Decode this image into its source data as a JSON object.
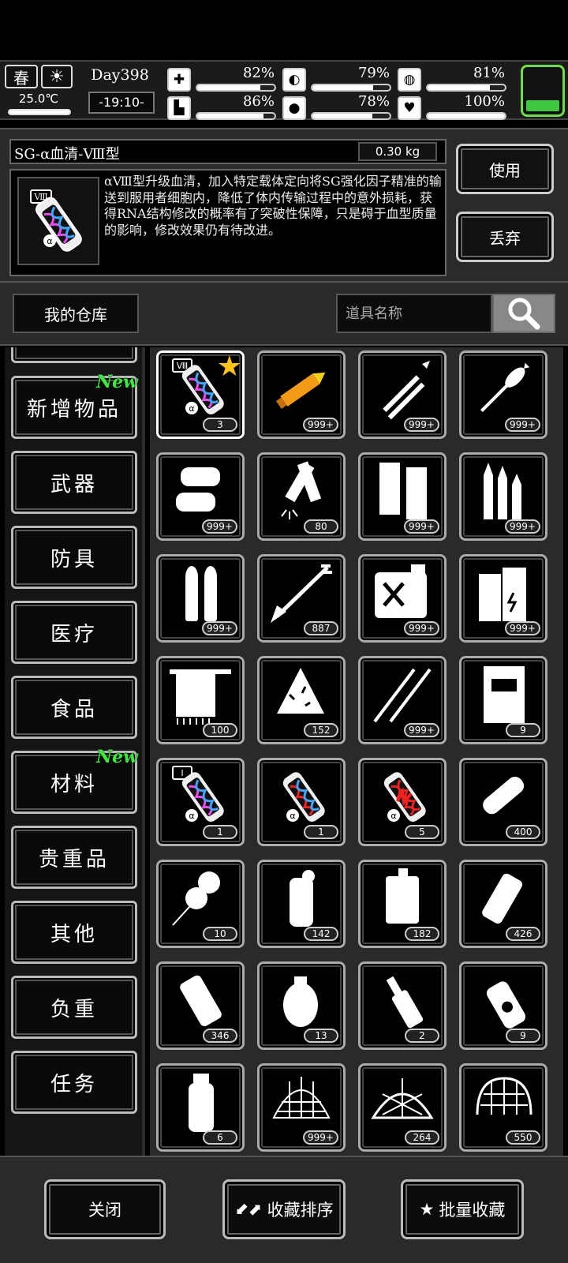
{
  "hud": {
    "season": "春",
    "temperature": "25.0℃",
    "day": "Day398",
    "time": "-19:10-",
    "stats": [
      {
        "name": "health",
        "icon": "medkit-icon",
        "glyph": "✚",
        "value": "82%",
        "level": 0.82
      },
      {
        "name": "hunger",
        "icon": "stomach-icon",
        "glyph": "◐",
        "value": "79%",
        "level": 0.79
      },
      {
        "name": "energy",
        "icon": "pill-icon",
        "glyph": "◍",
        "value": "81%",
        "level": 0.81
      },
      {
        "name": "stamina",
        "icon": "boot-icon",
        "glyph": "▙",
        "value": "86%",
        "level": 0.86
      },
      {
        "name": "thirst",
        "icon": "water-drop-icon",
        "glyph": "●",
        "value": "78%",
        "level": 0.78
      },
      {
        "name": "mood",
        "icon": "heart-icon",
        "glyph": "♥",
        "value": "100%",
        "level": 1.0
      }
    ],
    "battery_color": "#3cc840"
  },
  "detail": {
    "title": "SG-α血清-Ⅷ型",
    "weight": "0.30 kg",
    "description": "αⅧ型升级血清，加入特定载体定向将SG强化因子精准的输送到服用者细胞内，降低了体内传输过程中的意外损耗，获得RNA结构修改的概率有了突破性保障，只是碍于血型质量的影响，修改效果仍有待改进。",
    "use_label": "使用",
    "discard_label": "丢弃"
  },
  "warehouse": {
    "title": "我的仓库",
    "search_placeholder": "道具名称"
  },
  "categories": [
    {
      "label": "新增物品",
      "badge": "New"
    },
    {
      "label": "武器",
      "badge": ""
    },
    {
      "label": "防具",
      "badge": ""
    },
    {
      "label": "医疗",
      "badge": ""
    },
    {
      "label": "食品",
      "badge": ""
    },
    {
      "label": "材料",
      "badge": "New"
    },
    {
      "label": "贵重品",
      "badge": ""
    },
    {
      "label": "其他",
      "badge": ""
    },
    {
      "label": "负重",
      "badge": ""
    },
    {
      "label": "任务",
      "badge": ""
    }
  ],
  "items": [
    {
      "icon": "serum-viii-icon",
      "count": "3",
      "favorite": true,
      "selected": true
    },
    {
      "icon": "rocket-ammo-icon",
      "count": "999+"
    },
    {
      "icon": "rifle-bullets-icon",
      "count": "999+"
    },
    {
      "icon": "rpg-round-icon",
      "count": "999+"
    },
    {
      "icon": "pistol-bullets-icon",
      "count": "999+"
    },
    {
      "icon": "shotgun-shells-icon",
      "count": "80"
    },
    {
      "icon": "magazine-icon",
      "count": "999+"
    },
    {
      "icon": "cartridges-icon",
      "count": "999+"
    },
    {
      "icon": "bullet-pair-icon",
      "count": "999+"
    },
    {
      "icon": "arrow-icon",
      "count": "887"
    },
    {
      "icon": "fuel-can-icon",
      "count": "999+"
    },
    {
      "icon": "battery-pack-icon",
      "count": "999+"
    },
    {
      "icon": "towel-icon",
      "count": "100"
    },
    {
      "icon": "cloth-rag-icon",
      "count": "152"
    },
    {
      "icon": "lockpick-icon",
      "count": "999+"
    },
    {
      "icon": "book-icon",
      "count": "9"
    },
    {
      "icon": "serum-i-icon",
      "count": "1"
    },
    {
      "icon": "serum-red-icon",
      "count": "1"
    },
    {
      "icon": "serum-broken-icon",
      "count": "5"
    },
    {
      "icon": "glue-stick-icon",
      "count": "400"
    },
    {
      "icon": "balloon-bomb-icon",
      "count": "10"
    },
    {
      "icon": "flash-grenade-icon",
      "count": "142"
    },
    {
      "icon": "incendiary-canister-icon",
      "count": "182"
    },
    {
      "icon": "smoke-grenade-icon",
      "count": "426"
    },
    {
      "icon": "stun-grenade-icon",
      "count": "346"
    },
    {
      "icon": "frag-grenade-icon",
      "count": "13"
    },
    {
      "icon": "molotov-icon",
      "count": "2"
    },
    {
      "icon": "nuke-bottle-icon",
      "count": "9"
    },
    {
      "icon": "impact-grenade-icon",
      "count": "6"
    },
    {
      "icon": "barbed-net-icon",
      "count": "999+"
    },
    {
      "icon": "trap-net-icon",
      "count": "264"
    },
    {
      "icon": "mesh-helmet-icon",
      "count": "550"
    }
  ],
  "bottom": {
    "close_label": "关闭",
    "sort_label": "收藏排序",
    "batch_label": "批量收藏"
  }
}
